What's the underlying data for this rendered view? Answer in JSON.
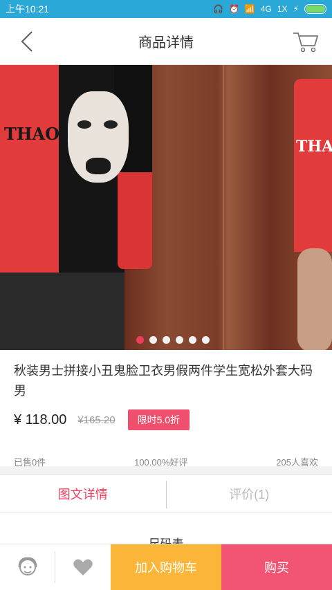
{
  "status": {
    "time": "上午10:21",
    "net": "4G",
    "speed": "1X"
  },
  "nav": {
    "title": "商品详情",
    "back_icon": "chevron-left-icon",
    "cart_icon": "shopping-cart-icon"
  },
  "gallery": {
    "dots": 6,
    "active_index": 0,
    "brand_text_left": "THAO",
    "brand_text_right": "THAO"
  },
  "product": {
    "title": "秋装男士拼接小丑鬼脸卫衣男假两件学生宽松外套大码男",
    "price": "¥ 118.00",
    "original_price": "¥165.20",
    "badge": "限时5.0折",
    "sold": "已售0件",
    "rating": "100.00%好评",
    "likes": "205人喜欢"
  },
  "tabs": [
    {
      "label": "图文详情",
      "active": true
    },
    {
      "label": "评价(1)",
      "active": false
    }
  ],
  "size_title": "——尺码表——",
  "bottom": {
    "add_cart": "加入购物车",
    "buy": "购买"
  },
  "colors": {
    "accent": "#ee3e5e",
    "status_bar": "#2aa8d8",
    "cart_btn": "#fbb63a",
    "buy_btn": "#f25573"
  }
}
